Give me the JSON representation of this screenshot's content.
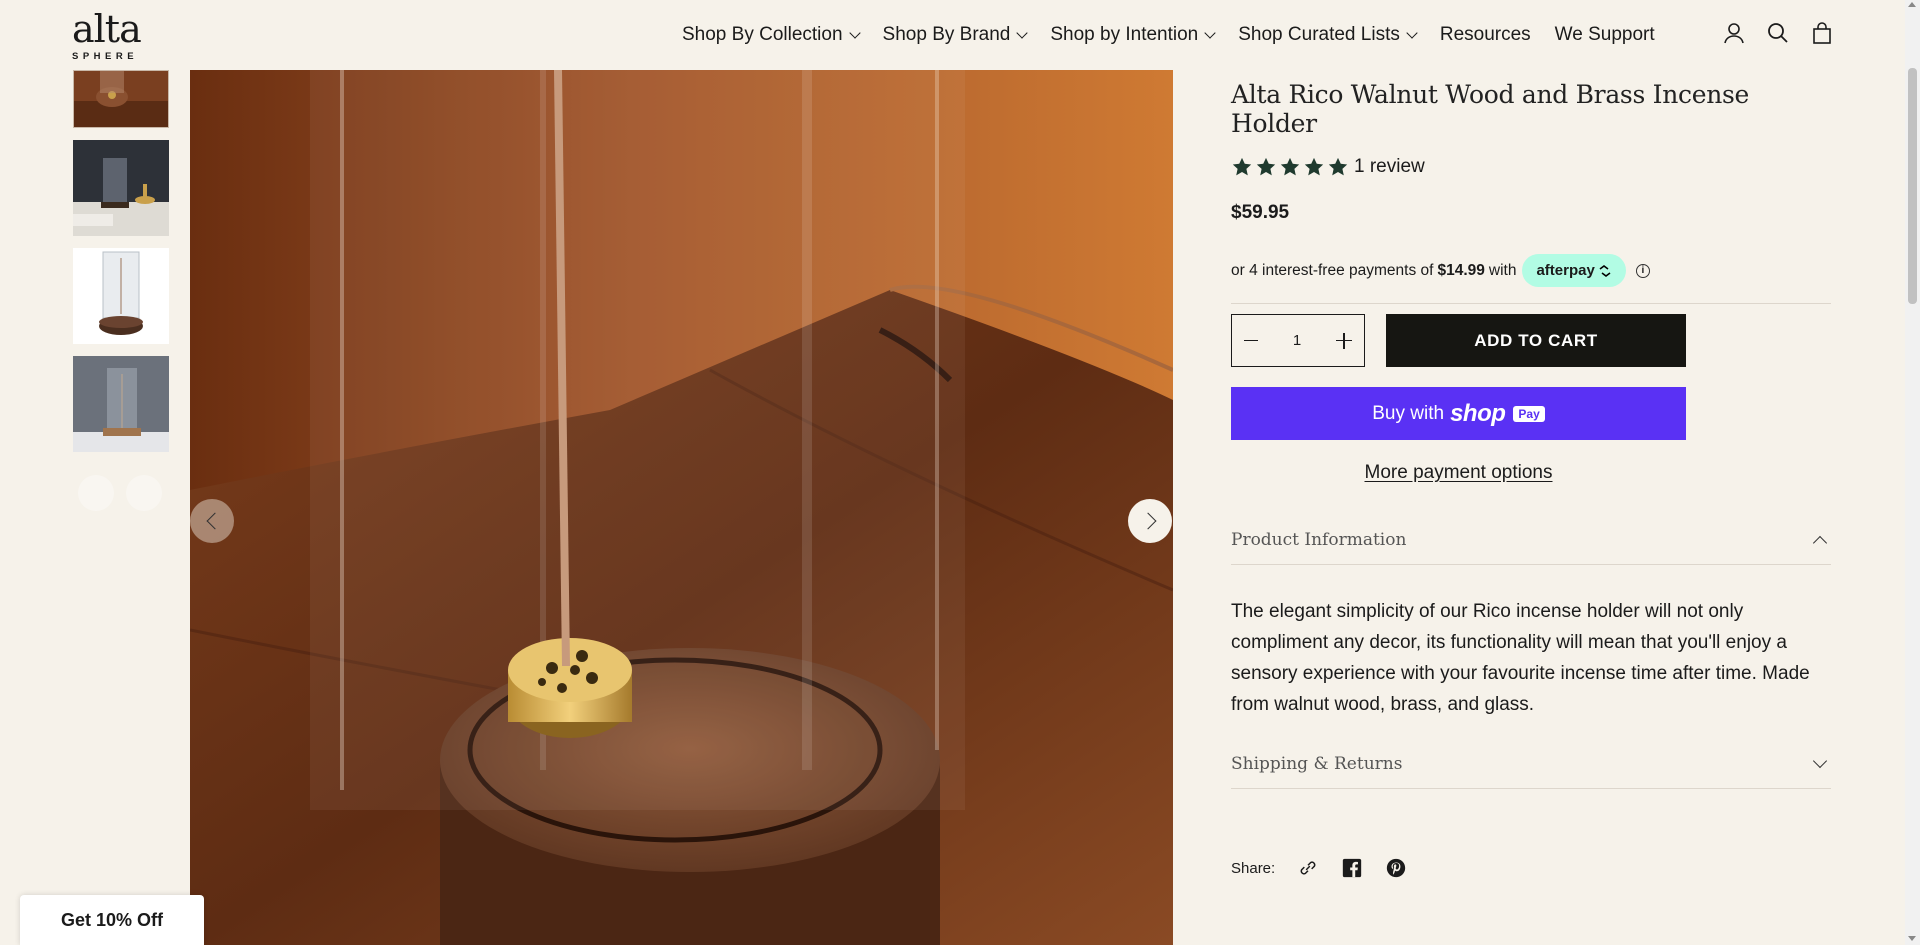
{
  "header": {
    "logo_main": "alta",
    "logo_sub": "SPHERE",
    "nav": [
      {
        "label": "Shop By Collection",
        "dropdown": true
      },
      {
        "label": "Shop By Brand",
        "dropdown": true
      },
      {
        "label": "Shop by Intention",
        "dropdown": true
      },
      {
        "label": "Shop Curated Lists",
        "dropdown": true
      },
      {
        "label": "Resources",
        "dropdown": false
      },
      {
        "label": "We Support",
        "dropdown": false
      }
    ],
    "icons": [
      "account-icon",
      "search-icon",
      "cart-icon"
    ]
  },
  "gallery": {
    "thumbnail_count": 4,
    "arrows": [
      "chevron-left-icon",
      "chevron-right-icon"
    ]
  },
  "product": {
    "title": "Alta Rico Walnut Wood and Brass Incense Holder",
    "rating": 5,
    "review_text": "1 review",
    "price": "$59.95",
    "afterpay": {
      "prefix": "or 4 interest-free payments of",
      "amount": "$14.99",
      "suffix": "with",
      "brand": "afterpay",
      "brand_color": "#b2fce4"
    },
    "quantity": "1",
    "add_to_cart": "ADD TO CART",
    "shop_pay": {
      "prefix": "Buy with",
      "brand": "shop",
      "badge": "Pay",
      "color": "#5a31f4"
    },
    "more_payment": "More payment options",
    "accordions": {
      "info_title": "Product Information",
      "info_body": "The elegant simplicity of our Rico incense holder will not only compliment any decor, its functionality will mean that you'll enjoy a sensory experience with your favourite incense time after time. Made from walnut wood, brass, and glass.",
      "shipping_title": "Shipping & Returns"
    },
    "share_label": "Share:",
    "share_icons": [
      "link-icon",
      "facebook-icon",
      "pinterest-icon"
    ]
  },
  "promo": {
    "label": "Get 10% Off"
  }
}
